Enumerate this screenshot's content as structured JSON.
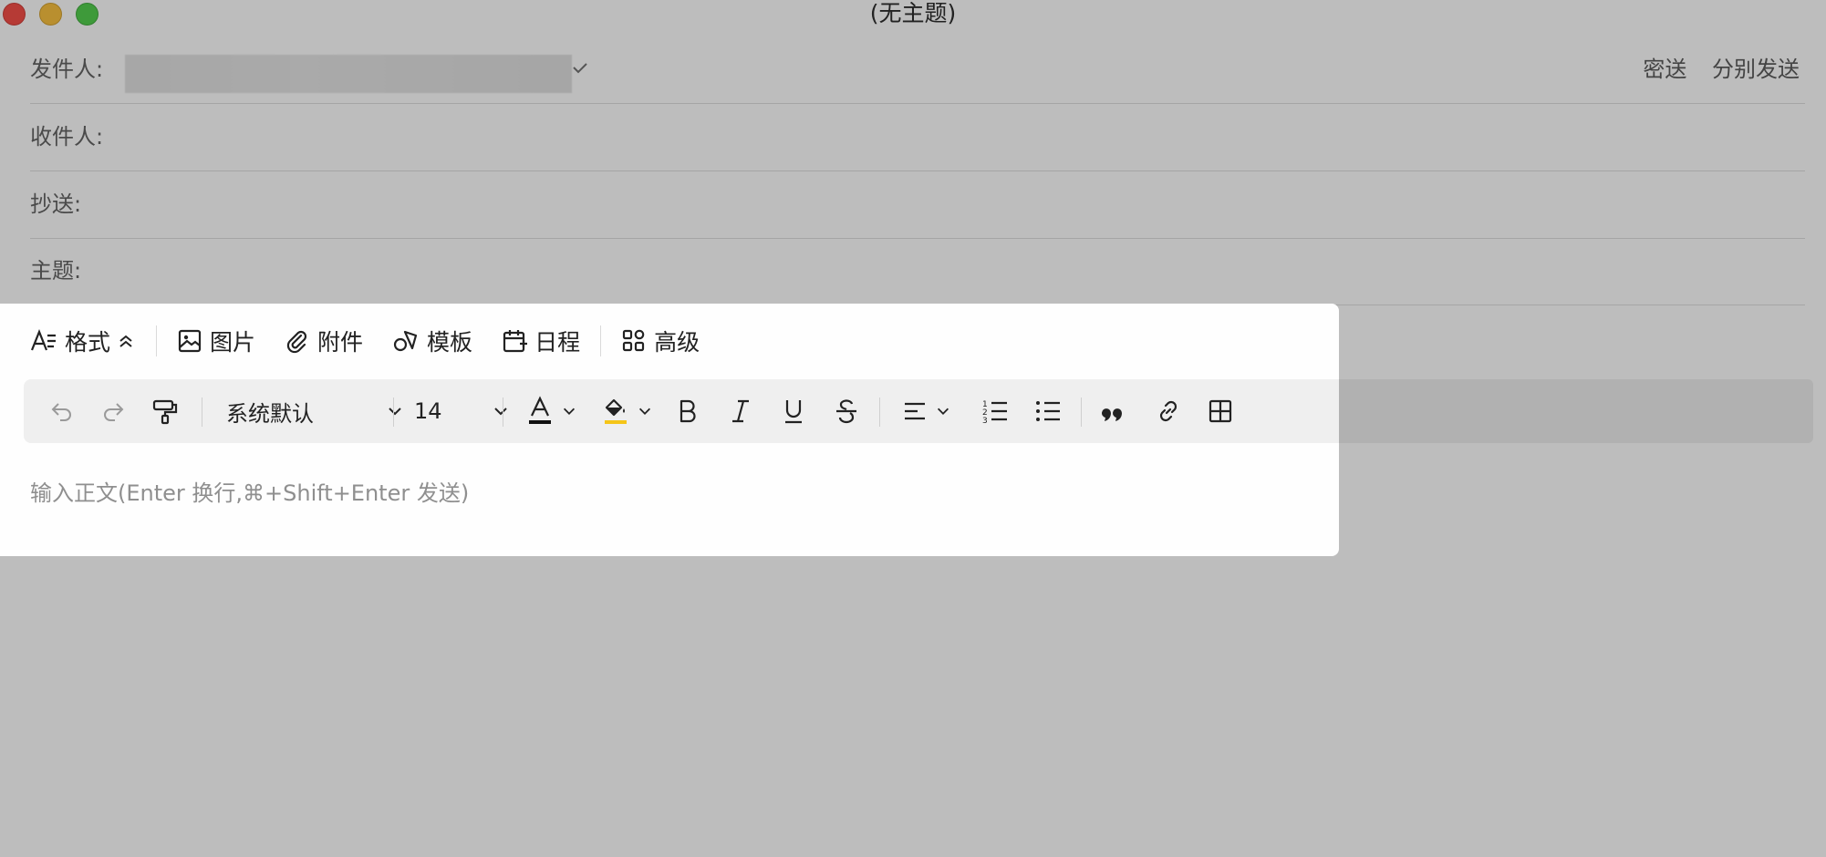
{
  "window": {
    "title": "(无主题)"
  },
  "header": {
    "sender_label": "发件人:",
    "recipient_label": "收件人:",
    "cc_label": "抄送:",
    "subject_label": "主题:",
    "bcc_label": "密送",
    "separate_send_label": "分别发送"
  },
  "topbar": {
    "format": "格式",
    "image": "图片",
    "attachment": "附件",
    "template": "模板",
    "schedule": "日程",
    "advanced": "高级"
  },
  "toolbar": {
    "font_family": "系统默认",
    "font_size": "14",
    "text_color": "#111111",
    "highlight_color": "#f5c518"
  },
  "body": {
    "placeholder": "输入正文(Enter 换行,⌘+Shift+Enter 发送)"
  }
}
